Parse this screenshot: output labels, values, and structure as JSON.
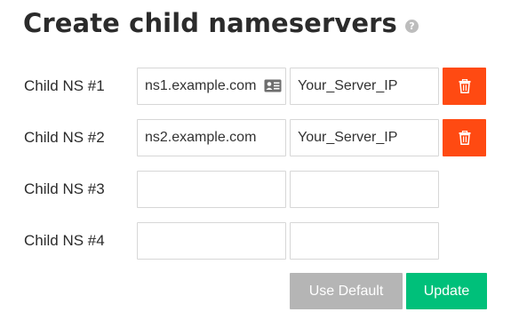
{
  "header": {
    "title": "Create child nameservers",
    "help_icon": "question-circle-icon"
  },
  "rows": [
    {
      "label": "Child NS #1",
      "hostname": "ns1.example.com",
      "ip": "Your_Server_IP",
      "has_contact_icon": true,
      "has_delete": true
    },
    {
      "label": "Child NS #2",
      "hostname": "ns2.example.com",
      "ip": "Your_Server_IP",
      "has_contact_icon": false,
      "has_delete": true
    },
    {
      "label": "Child NS #3",
      "hostname": "",
      "ip": "",
      "has_contact_icon": false,
      "has_delete": false
    },
    {
      "label": "Child NS #4",
      "hostname": "",
      "ip": "",
      "has_contact_icon": false,
      "has_delete": false
    }
  ],
  "actions": {
    "use_default_label": "Use Default",
    "update_label": "Update"
  },
  "colors": {
    "delete": "#ff4a12",
    "update": "#00c07a",
    "use_default": "#b5b5b5"
  },
  "icons": {
    "delete": "trash-icon",
    "autofill": "contact-card-icon"
  }
}
